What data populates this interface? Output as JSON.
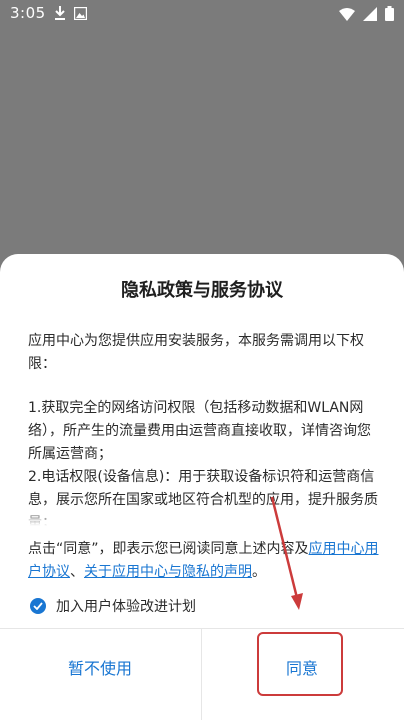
{
  "status_bar": {
    "time": "3:05"
  },
  "dialog": {
    "title": "隐私政策与服务协议",
    "intro": "应用中心为您提供应用安装服务，本服务需调用以下权限：",
    "item1": "1.获取完全的网络访问权限（包括移动数据和WLAN网络），所产生的流量费用由运营商直接收取，详情咨询您所属运营商；",
    "item2": "2.电话权限(设备信息)：用于获取设备标识符和运营商信息，展示您所在国家或地区符合机型的应用，提升服务质量；",
    "consent_prefix": "点击“同意”，即表示您已阅读同意上述内容及",
    "link_user_agreement": "应用中心用户协议",
    "consent_sep": "、",
    "link_privacy": "关于应用中心与隐私的声明",
    "consent_suffix": "。",
    "checkbox_label": "加入用户体验改进计划",
    "checkbox_checked": true,
    "decline_label": "暂不使用",
    "agree_label": "同意"
  },
  "colors": {
    "accent": "#1976d2",
    "annotation": "#cc3b3b"
  }
}
